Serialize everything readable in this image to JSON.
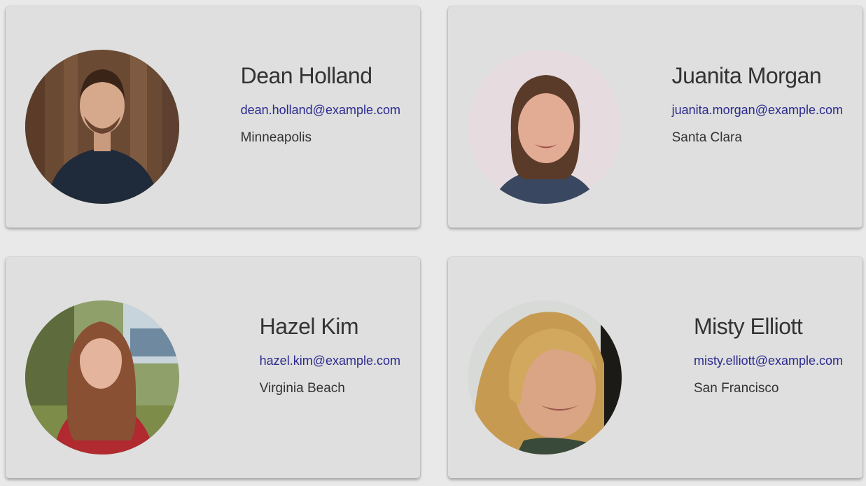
{
  "cards": [
    {
      "name": "Dean Holland",
      "email": "dean.holland@example.com",
      "city": "Minneapolis",
      "avatar_icon": "avatar-photo-man-wooden-background"
    },
    {
      "name": "Juanita Morgan",
      "email": "juanita.morgan@example.com",
      "city": "Santa Clara",
      "avatar_icon": "avatar-photo-woman-light-background"
    },
    {
      "name": "Hazel Kim",
      "email": "hazel.kim@example.com",
      "city": "Virginia Beach",
      "avatar_icon": "avatar-photo-woman-red-top-outdoors"
    },
    {
      "name": "Misty Elliott",
      "email": "misty.elliott@example.com",
      "city": "San Francisco",
      "avatar_icon": "avatar-photo-woman-blonde-closeup"
    }
  ],
  "colors": {
    "page_background": "#e9e9e9",
    "card_background": "#dfdfdf",
    "name_text": "#333333",
    "email_link": "#2a2a8f",
    "city_text": "#333333"
  }
}
